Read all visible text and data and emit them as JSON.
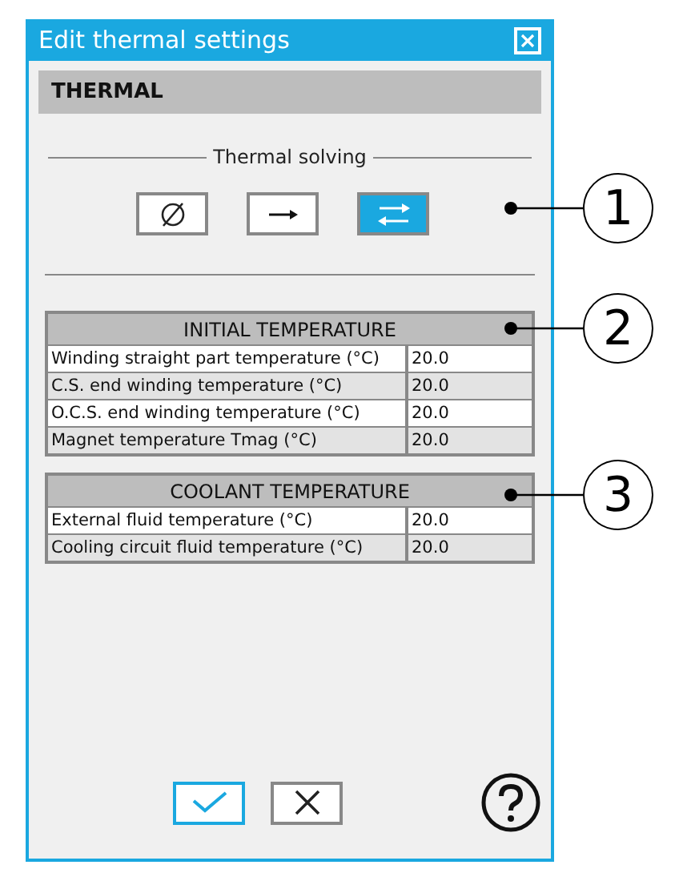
{
  "window": {
    "title": "Edit thermal settings"
  },
  "section": "THERMAL",
  "solving": {
    "label": "Thermal solving",
    "options": [
      {
        "kind": "none",
        "selected": false
      },
      {
        "kind": "one_way",
        "selected": false
      },
      {
        "kind": "two_way",
        "selected": true
      }
    ]
  },
  "tables": [
    {
      "title": "INITIAL TEMPERATURE",
      "rows": [
        {
          "label": "Winding straight part temperature (°C)",
          "value": "20.0"
        },
        {
          "label": "C.S. end winding temperature (°C)",
          "value": "20.0"
        },
        {
          "label": "O.C.S. end winding temperature (°C)",
          "value": "20.0"
        },
        {
          "label": "Magnet temperature Tmag (°C)",
          "value": "20.0"
        }
      ]
    },
    {
      "title": "COOLANT TEMPERATURE",
      "rows": [
        {
          "label": "External fluid temperature (°C)",
          "value": "20.0"
        },
        {
          "label": "Cooling circuit fluid temperature (°C)",
          "value": "20.0"
        }
      ]
    }
  ],
  "callouts": [
    "1",
    "2",
    "3"
  ]
}
